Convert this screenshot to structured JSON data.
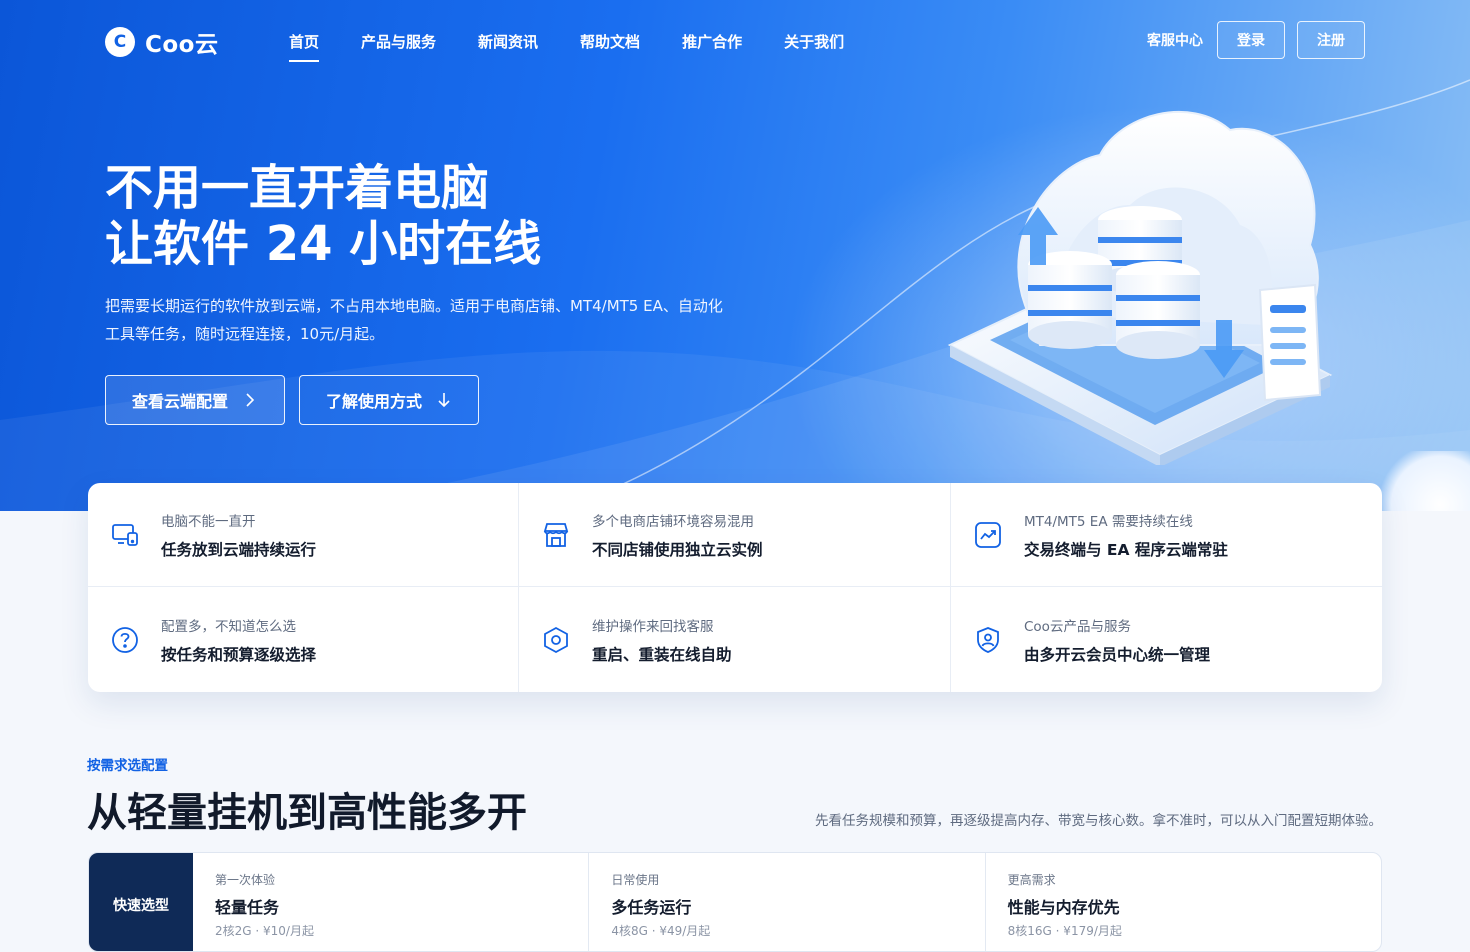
{
  "nav": {
    "logo_mark": "C",
    "logo_text": "Coo云",
    "links": [
      {
        "label": "首页",
        "active": true
      },
      {
        "label": "产品与服务"
      },
      {
        "label": "新闻资讯"
      },
      {
        "label": "帮助文档"
      },
      {
        "label": "推广合作"
      },
      {
        "label": "关于我们"
      }
    ],
    "service_label": "客服中心",
    "login_label": "登录",
    "register_label": "注册"
  },
  "hero": {
    "title_line1": "不用一直开着电脑",
    "title_line2": "让软件 24 小时在线",
    "desc": "把需要长期运行的软件放到云端，不占用本地电脑。适用于电商店铺、MT4/MT5 EA、自动化工具等任务，随时远程连接，10元/月起。",
    "btn_primary": "查看云端配置",
    "btn_secondary": "了解使用方式"
  },
  "features": [
    {
      "icon": "devices-icon",
      "sub": "电脑不能一直开",
      "main": "任务放到云端持续运行"
    },
    {
      "icon": "store-icon",
      "sub": "多个电商店铺环境容易混用",
      "main": "不同店铺使用独立云实例"
    },
    {
      "icon": "chart-trend-icon",
      "sub": "MT4/MT5 EA 需要持续在线",
      "main": "交易终端与 EA 程序云端常驻"
    },
    {
      "icon": "question-icon",
      "sub": "配置多，不知道怎么选",
      "main": "按任务和预算逐级选择"
    },
    {
      "icon": "settings-hex-icon",
      "sub": "维护操作来回找客服",
      "main": "重启、重装在线自助"
    },
    {
      "icon": "user-shield-icon",
      "sub": "Coo云产品与服务",
      "main": "由多开云会员中心统一管理"
    }
  ],
  "section": {
    "tag": "按需求选配置",
    "title": "从轻量挂机到高性能多开",
    "desc": "先看任务规模和预算，再逐级提高内存、带宽与核心数。拿不准时，可以从入门配置短期体验。"
  },
  "plans": {
    "quick_label": "快速选型",
    "items": [
      {
        "tag": "第一次体验",
        "name": "轻量任务",
        "spec": "2核2G · ¥10/月起"
      },
      {
        "tag": "日常使用",
        "name": "多任务运行",
        "spec": "4核8G · ¥49/月起"
      },
      {
        "tag": "更高需求",
        "name": "性能与内存优先",
        "spec": "8核16G · ¥179/月起"
      }
    ]
  }
}
